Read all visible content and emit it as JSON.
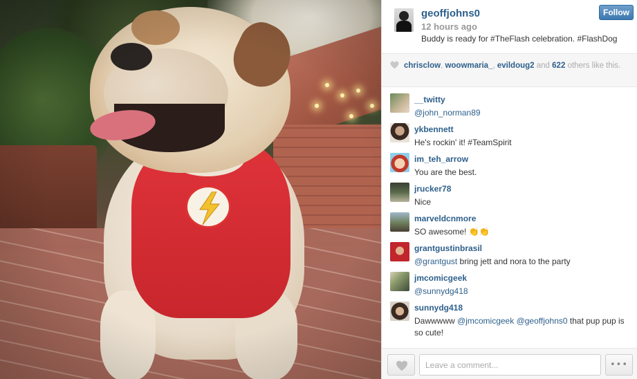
{
  "post": {
    "username": "geoffjohns0",
    "time_ago": "12 hours ago",
    "caption": "Buddy is ready for #TheFlash celebration. #FlashDog",
    "follow_label": "Follow"
  },
  "likes": {
    "users": [
      "chrisclow",
      "woowmaria_",
      "evildoug2"
    ],
    "and_word": "and",
    "count": "622",
    "suffix": "others like this."
  },
  "comments": [
    {
      "user": "__twitty",
      "mention": "@john_norman89",
      "text": ""
    },
    {
      "user": "ykbennett",
      "mention": "",
      "text": "He's rockin' it! #TeamSpirit"
    },
    {
      "user": "im_teh_arrow",
      "mention": "",
      "text": "You are the best."
    },
    {
      "user": "jrucker78",
      "mention": "",
      "text": "Nice"
    },
    {
      "user": "marveldcnmore",
      "mention": "",
      "text": "SO awesome! 👏👏"
    },
    {
      "user": "grantgustinbrasil",
      "mention": "@grantgust",
      "text": " bring jett and nora to the party"
    },
    {
      "user": "jmcomicgeek",
      "mention": "@sunnydg418",
      "text": ""
    },
    {
      "user": "sunnydg418",
      "mention": "",
      "text": "Dawwwww @jmcomicgeek @geoffjohns0 that pup pup is so cute!"
    }
  ],
  "footer": {
    "comment_placeholder": "Leave a comment...",
    "more_label": "•••"
  },
  "colors": {
    "link": "#2d5f8b",
    "follow_bg": "#3d79b0",
    "harness_red": "#d33030"
  },
  "icons": {
    "like": "heart-icon",
    "more": "ellipsis-icon",
    "emblem": "lightning-bolt-icon"
  }
}
